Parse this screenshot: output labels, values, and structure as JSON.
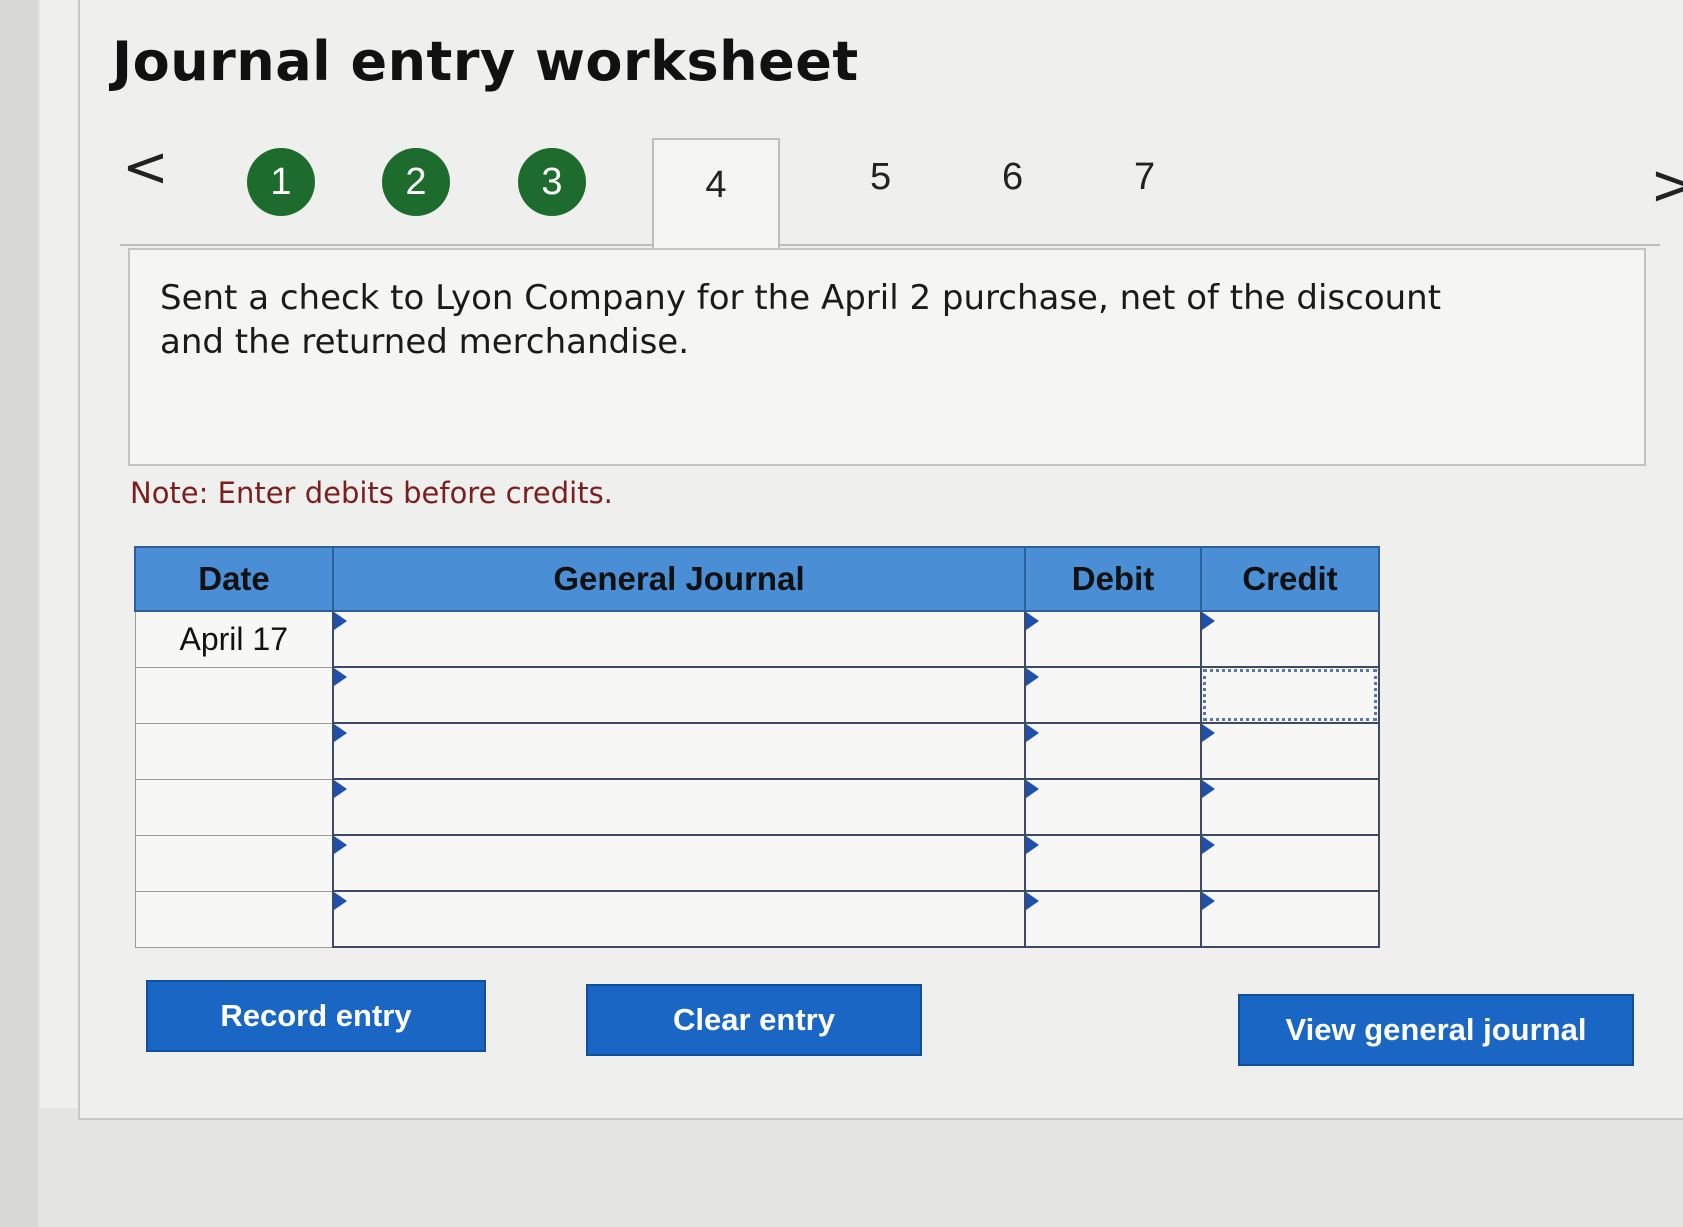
{
  "page": {
    "title": "Journal entry worksheet"
  },
  "nav": {
    "prev_icon": "chevron-left-icon",
    "next_icon": "chevron-right-icon",
    "prev_glyph": "<",
    "next_glyph": ">",
    "completed_steps": [
      "1",
      "2",
      "3"
    ],
    "active_step": "4",
    "remaining_steps": [
      "5",
      "6",
      "7"
    ],
    "completed_color": "#1e6b2e"
  },
  "question": {
    "text": "Sent a check to Lyon Company for the April 2 purchase, net of the discount and the returned merchandise."
  },
  "note": "Note: Enter debits before credits.",
  "table": {
    "headers": {
      "date": "Date",
      "general_journal": "General Journal",
      "debit": "Debit",
      "credit": "Credit"
    },
    "header_color": "#4a8fd6",
    "rows": [
      {
        "date": "April 17",
        "account": "",
        "debit": "",
        "credit": ""
      },
      {
        "date": "",
        "account": "",
        "debit": "",
        "credit": ""
      },
      {
        "date": "",
        "account": "",
        "debit": "",
        "credit": ""
      },
      {
        "date": "",
        "account": "",
        "debit": "",
        "credit": ""
      },
      {
        "date": "",
        "account": "",
        "debit": "",
        "credit": ""
      },
      {
        "date": "",
        "account": "",
        "debit": "",
        "credit": ""
      }
    ]
  },
  "buttons": {
    "record": "Record entry",
    "clear": "Clear entry",
    "view": "View general journal",
    "color": "#1a66c4"
  }
}
